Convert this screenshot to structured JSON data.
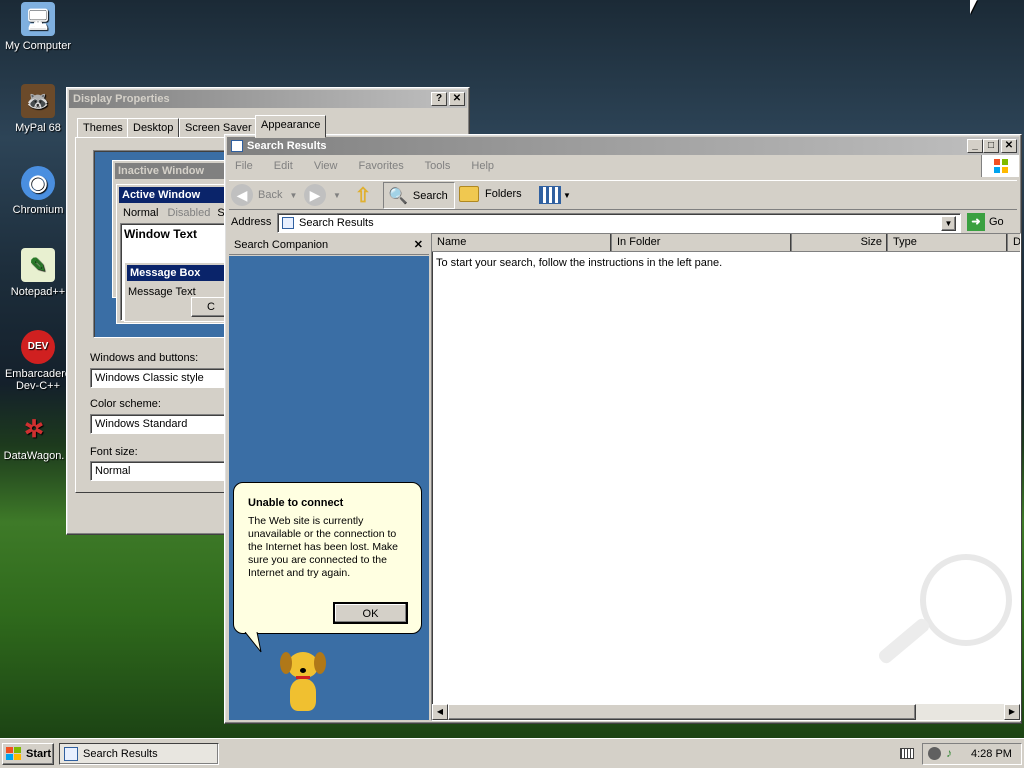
{
  "desktop": {
    "icons": [
      {
        "label": "My Computer",
        "glyph": "🖥"
      },
      {
        "label": "MyPal 68",
        "glyph": "🦝"
      },
      {
        "label": "Chromium",
        "glyph": "◉"
      },
      {
        "label": "Notepad++",
        "glyph": "✎"
      },
      {
        "label": "Embarcadero Dev-C++",
        "glyph": "DEV"
      },
      {
        "label": "DataWagon.",
        "glyph": "✲"
      }
    ]
  },
  "display_props": {
    "title": "Display Properties",
    "tabs": [
      "Themes",
      "Desktop",
      "Screen Saver",
      "Appearance"
    ],
    "active_tab": "Appearance",
    "preview": {
      "inactive": "Inactive Window",
      "active": "Active Window",
      "menu_normal": "Normal",
      "menu_disabled": "Disabled",
      "menu_selected": "S",
      "window_text": "Window Text",
      "message_box": "Message Box",
      "message_text": "Message Text",
      "ok_partial": "C"
    },
    "windows_buttons_label": "Windows and buttons:",
    "windows_buttons_value": "Windows Classic style",
    "color_scheme_label": "Color scheme:",
    "color_scheme_value": "Windows Standard",
    "font_size_label": "Font size:",
    "font_size_value": "Normal"
  },
  "search": {
    "title": "Search Results",
    "menu": [
      "File",
      "Edit",
      "View",
      "Favorites",
      "Tools",
      "Help"
    ],
    "toolbar": {
      "back": "Back",
      "search": "Search",
      "folders": "Folders"
    },
    "address_label": "Address",
    "address_value": "Search Results",
    "go_label": "Go",
    "companion_title": "Search Companion",
    "columns": [
      "Name",
      "In Folder",
      "Size",
      "Type",
      "D"
    ],
    "empty_message": "To start your search, follow the instructions in the left pane.",
    "balloon": {
      "title": "Unable to connect",
      "body": "The Web site is currently unavailable or the connection to the Internet has been lost. Make sure you are connected to the Internet and try again.",
      "ok": "OK"
    }
  },
  "taskbar": {
    "start": "Start",
    "task": "Search Results",
    "clock": "4:28 PM"
  }
}
